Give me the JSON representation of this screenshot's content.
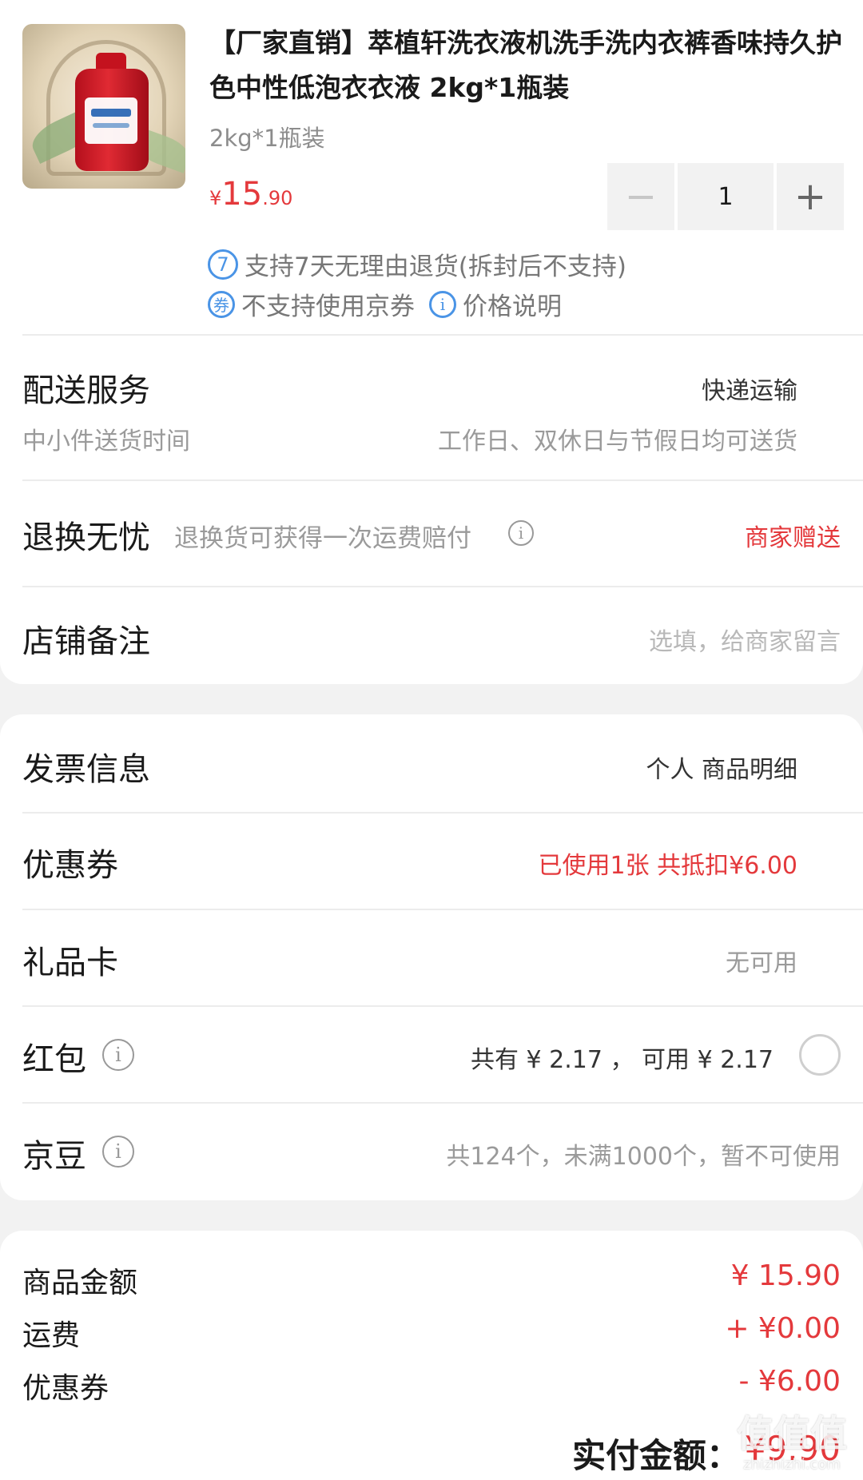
{
  "product": {
    "title": "【厂家直销】萃植轩洗衣液机洗手洗内衣裤香味持久护色中性低泡衣衣液 2kg*1瓶装",
    "spec": "2kg*1瓶装",
    "price_currency": "¥",
    "price_integer": "15",
    "price_decimal": ".90",
    "quantity": "1",
    "minus_icon": "−",
    "plus_icon": "+",
    "services": [
      {
        "icon": "7",
        "text": "支持7天无理由退货(拆封后不支持)"
      },
      {
        "icon": "券",
        "text": "不支持使用京券"
      },
      {
        "icon": "i",
        "text": "价格说明"
      }
    ]
  },
  "delivery": {
    "title": "配送服务",
    "value": "快递运输",
    "sub_label": "中小件送货时间",
    "sub_value": "工作日、双休日与节假日均可送货"
  },
  "return_worry_free": {
    "title": "退换无忧",
    "desc": "退换货可获得一次运费赔付",
    "info_icon": "i",
    "value": "商家赠送"
  },
  "store_note": {
    "title": "店铺备注",
    "placeholder": "选填，给商家留言"
  },
  "invoice": {
    "title": "发票信息",
    "value": "个人 商品明细"
  },
  "coupon": {
    "title": "优惠券",
    "value": "已使用1张 共抵扣¥6.00"
  },
  "gift_card": {
    "title": "礼品卡",
    "value": "无可用"
  },
  "red_packet": {
    "title": "红包",
    "info_icon": "i",
    "value": "共有 ¥ 2.17 ， 可用 ¥ 2.17"
  },
  "jingdou": {
    "title": "京豆",
    "info_icon": "i",
    "value": "共124个，未满1000个，暂不可使用"
  },
  "summary": {
    "items": [
      {
        "label": "商品金额",
        "value": "¥ 15.90"
      },
      {
        "label": "运费",
        "value": "+ ¥0.00"
      },
      {
        "label": "优惠券",
        "value": "- ¥6.00"
      }
    ],
    "total_label": "实付金额：",
    "total_value": "¥9.90"
  },
  "watermark": {
    "text": "值值值",
    "sub": "zhizhizhi.com"
  },
  "colors": {
    "accent_red": "#e4393c",
    "service_blue": "#4a94e6",
    "background": "#f2f2f2"
  }
}
